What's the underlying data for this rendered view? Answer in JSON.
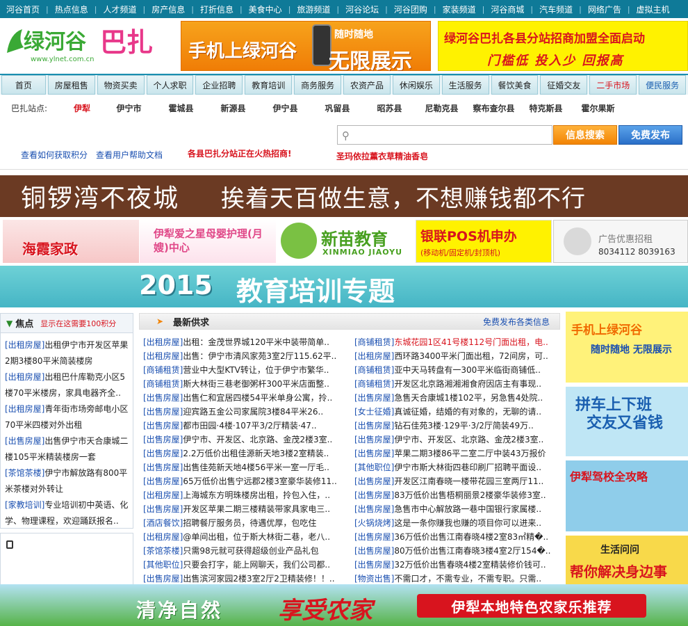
{
  "topbar": {
    "items": [
      "河谷首页",
      "热点信息",
      "人才频道",
      "房产信息",
      "打折信息",
      "美食中心",
      "旅游频道",
      "河谷论坛",
      "河谷团购",
      "家装频道",
      "河谷商城",
      "汽车频道",
      "网络广告",
      "虚拟主机"
    ]
  },
  "logo": {
    "text": "绿河谷巴扎",
    "url_text": "www.ylnet.com.cn"
  },
  "ad_phone": {
    "line1": "手机上绿河谷",
    "line2": "随时随地",
    "line3": "无限展示"
  },
  "ad_franchise": {
    "line1": "绿河谷巴扎各县分站招商加盟全面启动",
    "line2": "门槛低  投入少  回报高"
  },
  "nav": {
    "tabs": [
      "首页",
      "房屋租售",
      "物资买卖",
      "个人求职",
      "企业招聘",
      "教育培训",
      "商务服务",
      "农资产品",
      "休闲娱乐",
      "生活服务",
      "餐饮美食",
      "征婚交友",
      "二手市场",
      "便民服务"
    ]
  },
  "stations": {
    "label": "巴扎站点:",
    "items": [
      "伊犁",
      "伊宁市",
      "霍城县",
      "新源县",
      "伊宁县",
      "巩留县",
      "昭苏县",
      "尼勒克县",
      "察布查尔县",
      "特克斯县",
      "霍尔果斯"
    ]
  },
  "search": {
    "button": "信息搜索",
    "publish": "免费发布"
  },
  "help": {
    "points": "查看如何获取积分",
    "manual": "查看用户帮助文档",
    "recruit": "各县巴扎分站正在火热招商!",
    "promo": "圣玛依拉薰衣草精油香皂"
  },
  "banner1": {
    "left": "铜锣湾不夜城",
    "right": "挨着天百做生意，不想赚钱都不行"
  },
  "ads": {
    "haixia": "海霞家政",
    "aixing": "伊犁爱之星母婴护理(月嫂)中心",
    "xinmiao": "新苗教育",
    "xinmiao_en": "XINMIAO JIAOYU",
    "yinlian": "银联POS机申办",
    "yinlian_sub": "(移动机/固定机/封顶机)",
    "rent_title": "广告优惠招租",
    "rent_phone": "8034112  8039163"
  },
  "banner2": {
    "year": "2015",
    "text": "教育培训专题"
  },
  "focus": {
    "title": "焦点",
    "note": "显示在这需要100积分",
    "items": [
      {
        "tag": "[出租房屋]",
        "text": "出租伊宁市开发区苹果2期3楼80平米简装楼房"
      },
      {
        "tag": "[出租房屋]",
        "text": "出租巴什库勒克小区5楼70平米楼房，家具电器齐全.."
      },
      {
        "tag": "[出租房屋]",
        "text": "青年街市场旁邮电小区70平米四楼对外出租"
      },
      {
        "tag": "[出售房屋]",
        "text": "出售伊宁市天合康城二楼105平米精装楼房一套"
      },
      {
        "tag": "[茶馆茶楼]",
        "text": "伊宁市解放路有800平米茶楼对外转让"
      },
      {
        "tag": "[家教培训]",
        "text": "专业培训初中英语、化学、物理课程，欢迎踊跃报名.."
      }
    ]
  },
  "supply": {
    "title": "最新供求",
    "publish_link": "免费发布各类信息",
    "left": [
      {
        "tag": "[出租房屋]",
        "text": "出租：金茂世界城120平米中装带简单.."
      },
      {
        "tag": "[出租房屋]",
        "text": "出售：伊宁市清风家苑3室2厅115.62平.."
      },
      {
        "tag": "[商铺租赁]",
        "text": "营业中大型KTV转让，位于伊宁市繁华.."
      },
      {
        "tag": "[商铺租赁]",
        "text": "斯大林街三巷老御粥杆300平米店面整.."
      },
      {
        "tag": "[出售房屋]",
        "text": "出售仁和宜居四楼54平米单身公寓，拎.."
      },
      {
        "tag": "[出售房屋]",
        "text": "迎宾路五金公司家属院3楼84平米26.."
      },
      {
        "tag": "[出售房屋]",
        "text": "都市田园·4楼·107平3/2厅精装·47.."
      },
      {
        "tag": "[出售房屋]",
        "text": "伊宁市、开发区、北京路、金茂2楼3室.."
      },
      {
        "tag": "[出售房屋]",
        "text": "2.2万低价出租佳源新天地3楼2室精装.."
      },
      {
        "tag": "[出售房屋]",
        "text": "出售佳苑新天地4楼56平米一室一厅毛.."
      },
      {
        "tag": "[出售房屋]",
        "text": "65万低价出售宁远郡2楼3室豪华装修11.."
      },
      {
        "tag": "[出租房屋]",
        "text": "上海城东方明珠楼房出租，拎包入住，.."
      },
      {
        "tag": "[出售房屋]",
        "text": "开发区苹果二期三楼精装带家具家电三.."
      },
      {
        "tag": "[酒店餐饮]",
        "text": "招聘餐厅服务员，待遇优厚，包吃住"
      },
      {
        "tag": "[出租房屋]",
        "text": "@单间出租，位于斯大林街二巷，老八.."
      },
      {
        "tag": "[茶馆茶楼]",
        "text": "只需98元就可获得超级创业产品礼包"
      },
      {
        "tag": "[其他职位]",
        "text": "只要会打字，能上网聊天，我们公司都.."
      },
      {
        "tag": "[出售房屋]",
        "text": "出售滨河家园2楼3室2厅2卫精装修！！.."
      }
    ],
    "right": [
      {
        "tag": "[商铺租赁]",
        "text": "东城花园1区41号楼112号门面出租，电.."
      },
      {
        "tag": "[出租房屋]",
        "text": "西环路3400平米门面出租，72间房，可.."
      },
      {
        "tag": "[商铺租赁]",
        "text": "亚中天马转盘有一300平米临街商铺低.."
      },
      {
        "tag": "[商铺租赁]",
        "text": "开发区北京路湘湘湘食府因店主有事现.."
      },
      {
        "tag": "[出售房屋]",
        "text": "急售天合康城1楼102平，另急售4处院.."
      },
      {
        "tag": "[女士征婚]",
        "text": "真诚征婚，结婚的有对象的，无聊的请.."
      },
      {
        "tag": "[出售房屋]",
        "text": "钻石佳苑3楼·129平·3/2厅简装49万.."
      },
      {
        "tag": "[出售房屋]",
        "text": "伊宁市、开发区、北京路、金茂2楼3室.."
      },
      {
        "tag": "[出售房屋]",
        "text": "苹果二期3楼86平二室二厅中装43万报价"
      },
      {
        "tag": "[其他职位]",
        "text": "伊宁市斯大林街四巷印刷厂招聘平面设.."
      },
      {
        "tag": "[出售房屋]",
        "text": "开发区江南春晓一楼带花园三室两厅11.."
      },
      {
        "tag": "[出售房屋]",
        "text": "83万低价出售梧桐丽景2楼豪华装修3室.."
      },
      {
        "tag": "[出售房屋]",
        "text": "急售市中心解放路一巷中国银行家属楼.."
      },
      {
        "tag": "[火锅烧烤]",
        "text": "这是一条你赚我也赚的项目你可以进来.."
      },
      {
        "tag": "[出售房屋]",
        "text": "36万低价出售江南春晓4楼2室83㎡精�.."
      },
      {
        "tag": "[出售房屋]",
        "text": "80万低价出售江南春晓3楼4室2厅154�.."
      },
      {
        "tag": "[出售房屋]",
        "text": "32万低价出售春晓4楼2室精装修价钱可.."
      },
      {
        "tag": "[物资出售]",
        "text": "不需口才，不需专业，不需专职。只需.."
      }
    ]
  },
  "right_ads": {
    "ad1_title": "手机上绿河谷",
    "ad1_sub": "随时随地 无限展示",
    "ad2_line1": "拼车上下班",
    "ad2_line2": "交友又省钱",
    "ad3": "伊犁驾校全攻略",
    "ad4_title": "生活问问",
    "ad4_sub": "帮你解决身边事"
  },
  "footer": {
    "left": "清净自然",
    "mid": "享受农家",
    "right": "伊犁本地特色农家乐推荐"
  },
  "colors": {
    "topbar": "#0f7a98",
    "accent_red": "#d8141e",
    "link_blue": "#1a4fb0",
    "orange": "#f28405"
  }
}
